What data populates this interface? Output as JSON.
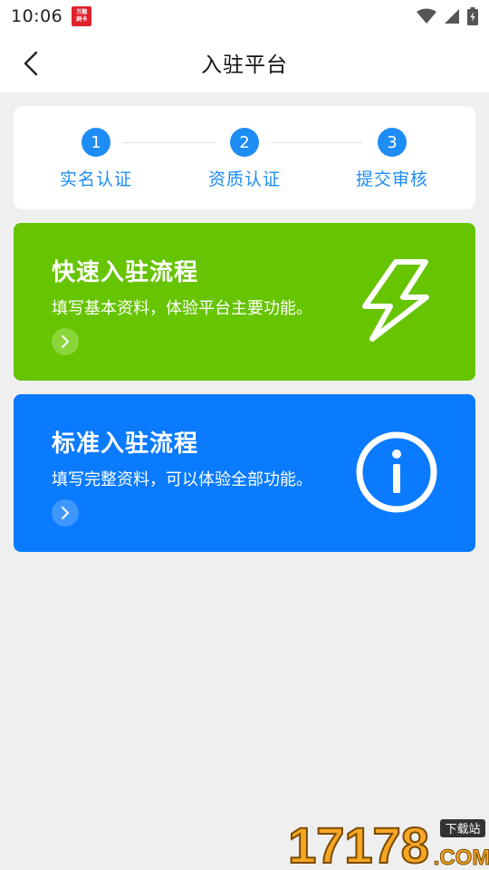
{
  "status_bar": {
    "time": "10:06",
    "badge_line1": "万题",
    "badge_line2": "刷卡"
  },
  "header": {
    "title": "入驻平台"
  },
  "steps": [
    {
      "number": "1",
      "label": "实名认证"
    },
    {
      "number": "2",
      "label": "资质认证"
    },
    {
      "number": "3",
      "label": "提交审核"
    }
  ],
  "quick_flow": {
    "title": "快速入驻流程",
    "description": "填写基本资料，体验平台主要功能。",
    "icon": "lightning-icon"
  },
  "standard_flow": {
    "title": "标准入驻流程",
    "description": "填写完整资料，可以体验全部功能。",
    "icon": "info-icon"
  },
  "watermark": {
    "digits": "17178",
    "tag": "下载站",
    "suffix": ".COM"
  },
  "colors": {
    "step_blue": "#1e8cf5",
    "quick_green": "#66c400",
    "standard_blue": "#0a7bff",
    "background": "#efefef"
  }
}
